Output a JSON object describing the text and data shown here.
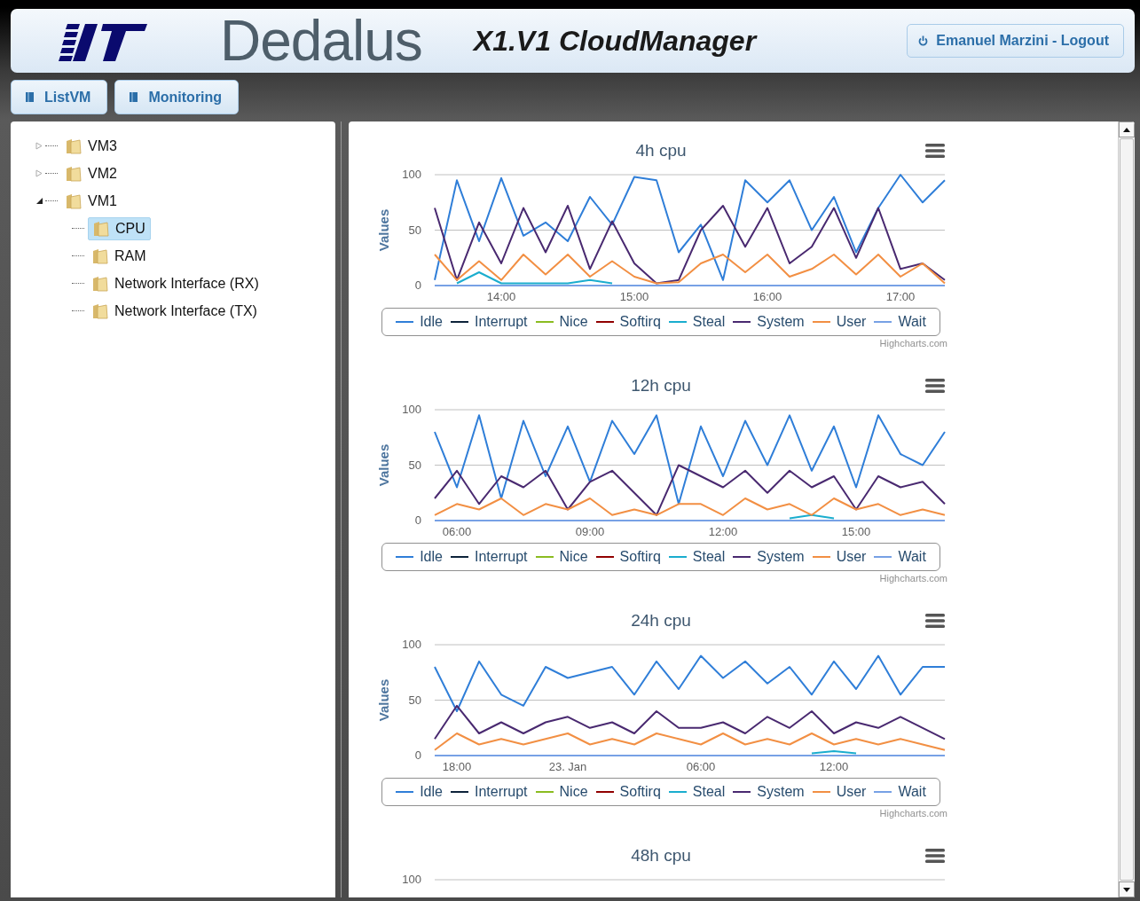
{
  "header": {
    "brand": "Dedalus",
    "app_title": "X1.V1 CloudManager",
    "user_button": "Emanuel Marzini - Logout"
  },
  "nav": [
    {
      "label": "ListVM"
    },
    {
      "label": "Monitoring"
    }
  ],
  "tree": [
    {
      "label": "VM3",
      "expanded": false,
      "selected": false
    },
    {
      "label": "VM2",
      "expanded": false,
      "selected": false
    },
    {
      "label": "VM1",
      "expanded": true,
      "selected": false,
      "children": [
        {
          "label": "CPU",
          "selected": true
        },
        {
          "label": "RAM",
          "selected": false
        },
        {
          "label": "Network Interface (RX)",
          "selected": false
        },
        {
          "label": "Network Interface (TX)",
          "selected": false
        }
      ]
    }
  ],
  "charts": [
    {
      "credits": "Highcharts.com",
      "chart_data": {
        "type": "line",
        "title": "4h cpu",
        "ylabel": "Values",
        "legend": true,
        "categories": [
          null,
          null,
          null,
          "14:00",
          null,
          null,
          null,
          null,
          null,
          "15:00",
          null,
          null,
          null,
          null,
          null,
          "16:00",
          null,
          null,
          null,
          null,
          null,
          "17:00",
          null,
          null
        ],
        "ylim": [
          0,
          100
        ],
        "yticks": [
          0,
          50,
          100
        ],
        "series": [
          {
            "name": "Idle",
            "color": "#2f7ed8",
            "values": [
              5,
              95,
              40,
              97,
              45,
              57,
              40,
              80,
              55,
              98,
              95,
              30,
              55,
              5,
              95,
              75,
              95,
              50,
              80,
              30,
              70,
              100,
              75,
              95
            ]
          },
          {
            "name": "Interrupt",
            "color": "#0d233a",
            "values": [
              null,
              null,
              null,
              null,
              null,
              null,
              null,
              null,
              null,
              null,
              null,
              null,
              null,
              null,
              null,
              null,
              null,
              null,
              null,
              null,
              null,
              null,
              null,
              null
            ]
          },
          {
            "name": "Nice",
            "color": "#8bbc21",
            "values": [
              null,
              null,
              null,
              null,
              null,
              null,
              null,
              null,
              null,
              null,
              null,
              null,
              null,
              null,
              null,
              null,
              null,
              null,
              null,
              null,
              null,
              null,
              null,
              null
            ]
          },
          {
            "name": "Softirq",
            "color": "#910000",
            "values": [
              null,
              null,
              null,
              null,
              null,
              null,
              null,
              null,
              null,
              null,
              null,
              null,
              null,
              null,
              null,
              null,
              null,
              null,
              null,
              null,
              null,
              null,
              null,
              null
            ]
          },
          {
            "name": "Steal",
            "color": "#1aadce",
            "values": [
              null,
              2,
              12,
              2,
              null,
              null,
              2,
              5,
              2,
              null,
              null,
              null,
              null,
              null,
              null,
              null,
              null,
              null,
              null,
              null,
              null,
              null,
              null,
              null
            ]
          },
          {
            "name": "System",
            "color": "#492970",
            "values": [
              70,
              5,
              57,
              20,
              70,
              30,
              72,
              15,
              58,
              20,
              2,
              5,
              50,
              72,
              35,
              70,
              20,
              35,
              70,
              25,
              70,
              15,
              20,
              5
            ]
          },
          {
            "name": "User",
            "color": "#f28f43",
            "values": [
              28,
              5,
              22,
              5,
              28,
              10,
              28,
              8,
              22,
              8,
              2,
              3,
              20,
              28,
              12,
              28,
              8,
              15,
              28,
              10,
              28,
              8,
              20,
              2
            ]
          },
          {
            "name": "Wait",
            "color": "#77a1e5",
            "values": [
              0,
              0,
              0,
              0,
              0,
              0,
              0,
              0,
              0,
              0,
              0,
              0,
              0,
              0,
              0,
              0,
              0,
              0,
              0,
              0,
              0,
              0,
              0,
              0
            ]
          }
        ]
      }
    },
    {
      "credits": "Highcharts.com",
      "chart_data": {
        "type": "line",
        "title": "12h cpu",
        "ylabel": "Values",
        "legend": true,
        "categories": [
          null,
          "06:00",
          null,
          null,
          null,
          null,
          null,
          "09:00",
          null,
          null,
          null,
          null,
          null,
          "12:00",
          null,
          null,
          null,
          null,
          null,
          "15:00",
          null,
          null,
          null,
          null
        ],
        "ylim": [
          0,
          100
        ],
        "yticks": [
          0,
          50,
          100
        ],
        "series": [
          {
            "name": "Idle",
            "color": "#2f7ed8",
            "values": [
              80,
              30,
              95,
              20,
              90,
              40,
              85,
              35,
              90,
              60,
              95,
              15,
              85,
              40,
              90,
              50,
              95,
              45,
              85,
              30,
              95,
              60,
              50,
              80
            ]
          },
          {
            "name": "Interrupt",
            "color": "#0d233a",
            "values": [
              null,
              null,
              null,
              null,
              null,
              null,
              null,
              null,
              null,
              null,
              null,
              null,
              null,
              null,
              null,
              null,
              null,
              null,
              null,
              null,
              null,
              null,
              null,
              null
            ]
          },
          {
            "name": "Nice",
            "color": "#8bbc21",
            "values": [
              null,
              null,
              null,
              null,
              null,
              null,
              null,
              null,
              null,
              null,
              null,
              null,
              null,
              null,
              null,
              null,
              null,
              null,
              null,
              null,
              null,
              null,
              null,
              null
            ]
          },
          {
            "name": "Softirq",
            "color": "#910000",
            "values": [
              null,
              null,
              null,
              null,
              null,
              null,
              null,
              null,
              null,
              null,
              null,
              null,
              null,
              null,
              null,
              null,
              null,
              null,
              null,
              null,
              null,
              null,
              null,
              null
            ]
          },
          {
            "name": "Steal",
            "color": "#1aadce",
            "values": [
              null,
              null,
              null,
              null,
              null,
              null,
              null,
              null,
              null,
              null,
              null,
              null,
              null,
              null,
              null,
              null,
              2,
              5,
              2,
              null,
              null,
              null,
              null,
              null
            ]
          },
          {
            "name": "System",
            "color": "#492970",
            "values": [
              20,
              45,
              15,
              40,
              30,
              45,
              10,
              35,
              45,
              25,
              5,
              50,
              40,
              30,
              45,
              25,
              45,
              30,
              40,
              10,
              40,
              30,
              35,
              15
            ]
          },
          {
            "name": "User",
            "color": "#f28f43",
            "values": [
              5,
              15,
              10,
              20,
              5,
              15,
              10,
              20,
              5,
              10,
              5,
              15,
              15,
              5,
              20,
              10,
              15,
              5,
              20,
              10,
              15,
              5,
              10,
              5
            ]
          },
          {
            "name": "Wait",
            "color": "#77a1e5",
            "values": [
              0,
              0,
              0,
              0,
              0,
              0,
              0,
              0,
              0,
              0,
              0,
              0,
              0,
              0,
              0,
              0,
              0,
              0,
              0,
              0,
              0,
              0,
              0,
              0
            ]
          }
        ]
      }
    },
    {
      "credits": "Highcharts.com",
      "chart_data": {
        "type": "line",
        "title": "24h cpu",
        "ylabel": "Values",
        "legend": true,
        "categories": [
          null,
          "18:00",
          null,
          null,
          null,
          null,
          "23. Jan",
          null,
          null,
          null,
          null,
          null,
          "06:00",
          null,
          null,
          null,
          null,
          null,
          "12:00",
          null,
          null,
          null,
          null,
          null
        ],
        "ylim": [
          0,
          100
        ],
        "yticks": [
          0,
          50,
          100
        ],
        "series": [
          {
            "name": "Idle",
            "color": "#2f7ed8",
            "values": [
              80,
              40,
              85,
              55,
              45,
              80,
              70,
              75,
              80,
              55,
              85,
              60,
              90,
              70,
              85,
              65,
              80,
              55,
              85,
              60,
              90,
              55,
              80,
              80
            ]
          },
          {
            "name": "Interrupt",
            "color": "#0d233a",
            "values": [
              null,
              null,
              null,
              null,
              null,
              null,
              null,
              null,
              null,
              null,
              null,
              null,
              null,
              null,
              null,
              null,
              null,
              null,
              null,
              null,
              null,
              null,
              null,
              null
            ]
          },
          {
            "name": "Nice",
            "color": "#8bbc21",
            "values": [
              null,
              null,
              null,
              null,
              null,
              null,
              null,
              null,
              null,
              null,
              null,
              null,
              null,
              null,
              null,
              null,
              null,
              null,
              null,
              null,
              null,
              null,
              null,
              null
            ]
          },
          {
            "name": "Softirq",
            "color": "#910000",
            "values": [
              null,
              null,
              null,
              null,
              null,
              null,
              null,
              null,
              null,
              null,
              null,
              null,
              null,
              null,
              null,
              null,
              null,
              null,
              null,
              null,
              null,
              null,
              null,
              null
            ]
          },
          {
            "name": "Steal",
            "color": "#1aadce",
            "values": [
              null,
              null,
              null,
              null,
              null,
              null,
              null,
              null,
              null,
              null,
              null,
              null,
              null,
              null,
              null,
              null,
              null,
              2,
              4,
              2,
              null,
              null,
              null,
              null
            ]
          },
          {
            "name": "System",
            "color": "#492970",
            "values": [
              15,
              45,
              20,
              30,
              20,
              30,
              35,
              25,
              30,
              20,
              40,
              25,
              25,
              30,
              20,
              35,
              25,
              40,
              20,
              30,
              25,
              35,
              25,
              15
            ]
          },
          {
            "name": "User",
            "color": "#f28f43",
            "values": [
              5,
              20,
              10,
              15,
              10,
              15,
              20,
              10,
              15,
              10,
              20,
              15,
              10,
              20,
              10,
              15,
              10,
              20,
              10,
              15,
              10,
              15,
              10,
              5
            ]
          },
          {
            "name": "Wait",
            "color": "#77a1e5",
            "values": [
              0,
              0,
              0,
              0,
              0,
              0,
              0,
              0,
              0,
              0,
              0,
              0,
              0,
              0,
              0,
              0,
              0,
              0,
              0,
              0,
              0,
              0,
              0,
              0
            ]
          }
        ]
      }
    },
    {
      "chart_data": {
        "type": "other",
        "title": "48h cpu",
        "annotations": [
          {
            "text": "100"
          }
        ]
      }
    }
  ]
}
